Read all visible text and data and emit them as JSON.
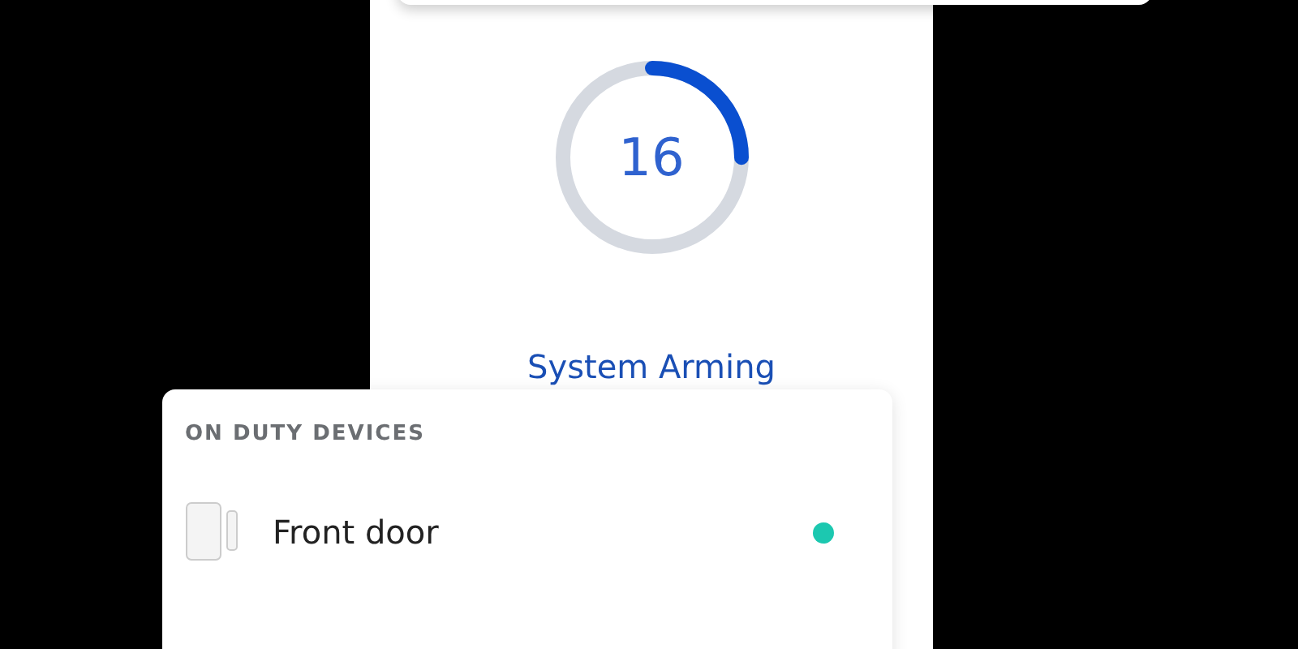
{
  "countdown": {
    "value": "16",
    "level": 0.25,
    "label": "System Arming"
  },
  "devices_card": {
    "heading": "ON DUTY DEVICES",
    "devices": [
      {
        "name": "Front door",
        "on": true
      }
    ]
  }
}
